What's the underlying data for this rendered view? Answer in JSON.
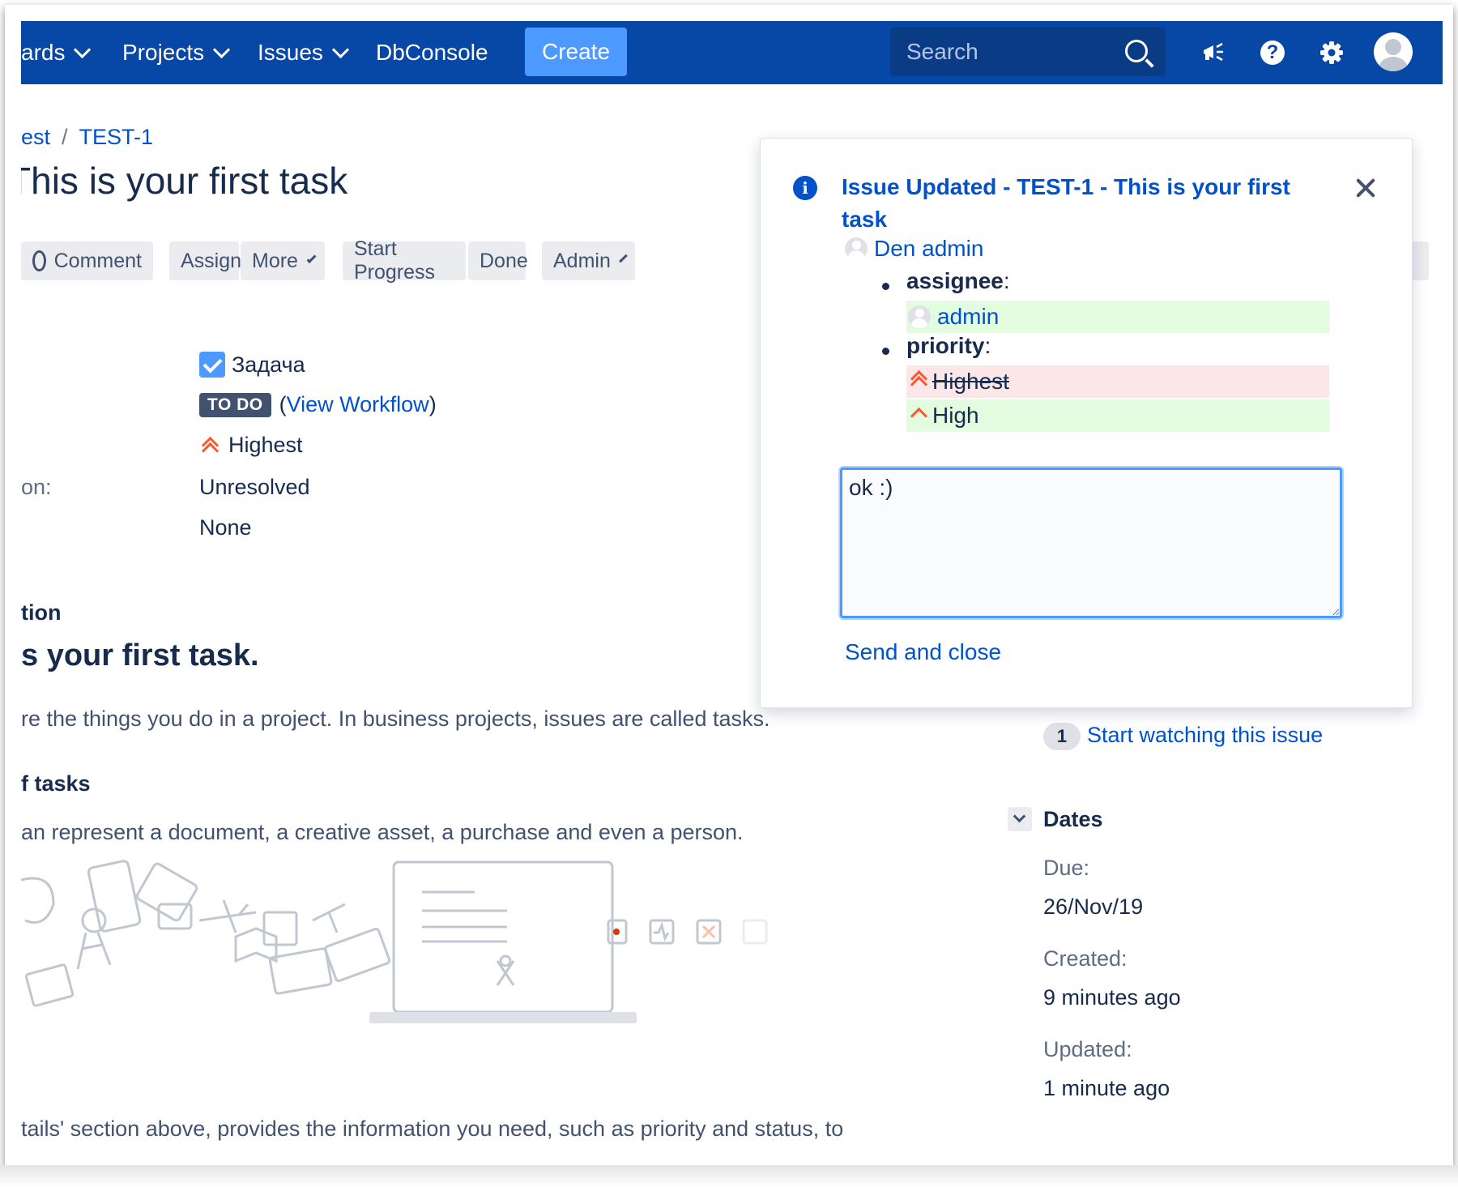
{
  "nav": {
    "dashboards_label": "ards",
    "projects_label": "Projects",
    "issues_label": "Issues",
    "dbconsole_label": "DbConsole",
    "create_label": "Create",
    "search_placeholder": "Search",
    "icons": [
      "megaphone-icon",
      "help-icon",
      "gear-icon",
      "avatar"
    ]
  },
  "breadcrumb": {
    "project": "est",
    "separator": "/",
    "issue_key": "TEST-1"
  },
  "issue": {
    "title": "his is your first task",
    "title_prefix": "T"
  },
  "ops": {
    "comment": "Comment",
    "assign": "Assign",
    "more": "More",
    "start_progress": "Start Progress",
    "done": "Done",
    "admin": "Admin"
  },
  "details": {
    "type": "Задача",
    "status": "TO DO",
    "view_workflow_open": "(",
    "view_workflow": "View Workflow",
    "view_workflow_close": ")",
    "priority": "Highest",
    "resolution_label": "on:",
    "resolution": "Unresolved",
    "fix_version": "None"
  },
  "description": {
    "section_title": "tion",
    "heading": "s your first task.",
    "paragraph1": "re the things you do in a project. In business projects, issues are called tasks.",
    "subheading": "f tasks",
    "paragraph2": "an represent a document, a creative asset, a purchase and even a person.",
    "paragraph3": "tails' section above, provides the information you need, such as priority and status, to"
  },
  "people": {
    "watch_count": "1",
    "watch_label": "Start watching this issue"
  },
  "dates": {
    "section_title": "Dates",
    "due_label": "Due:",
    "due": "26/Nov/19",
    "created_label": "Created:",
    "created": "9 minutes ago",
    "updated_label": "Updated:",
    "updated": "1 minute ago"
  },
  "popup": {
    "title": "Issue Updated - TEST-1 - This is your first task",
    "author": "Den admin",
    "changes": [
      {
        "field": "assignee",
        "new": "admin"
      },
      {
        "field": "priority",
        "old": "Highest",
        "new": "High"
      }
    ],
    "colon": ":",
    "reply_text": "ok :)",
    "send_label": "Send and close"
  },
  "colors": {
    "nav_bg": "#0747a6",
    "create_bg": "#4c9aff",
    "link": "#0052cc",
    "priority": "#ff5630",
    "diff_added": "#e3fcdf",
    "diff_removed": "#fbe7e7"
  }
}
